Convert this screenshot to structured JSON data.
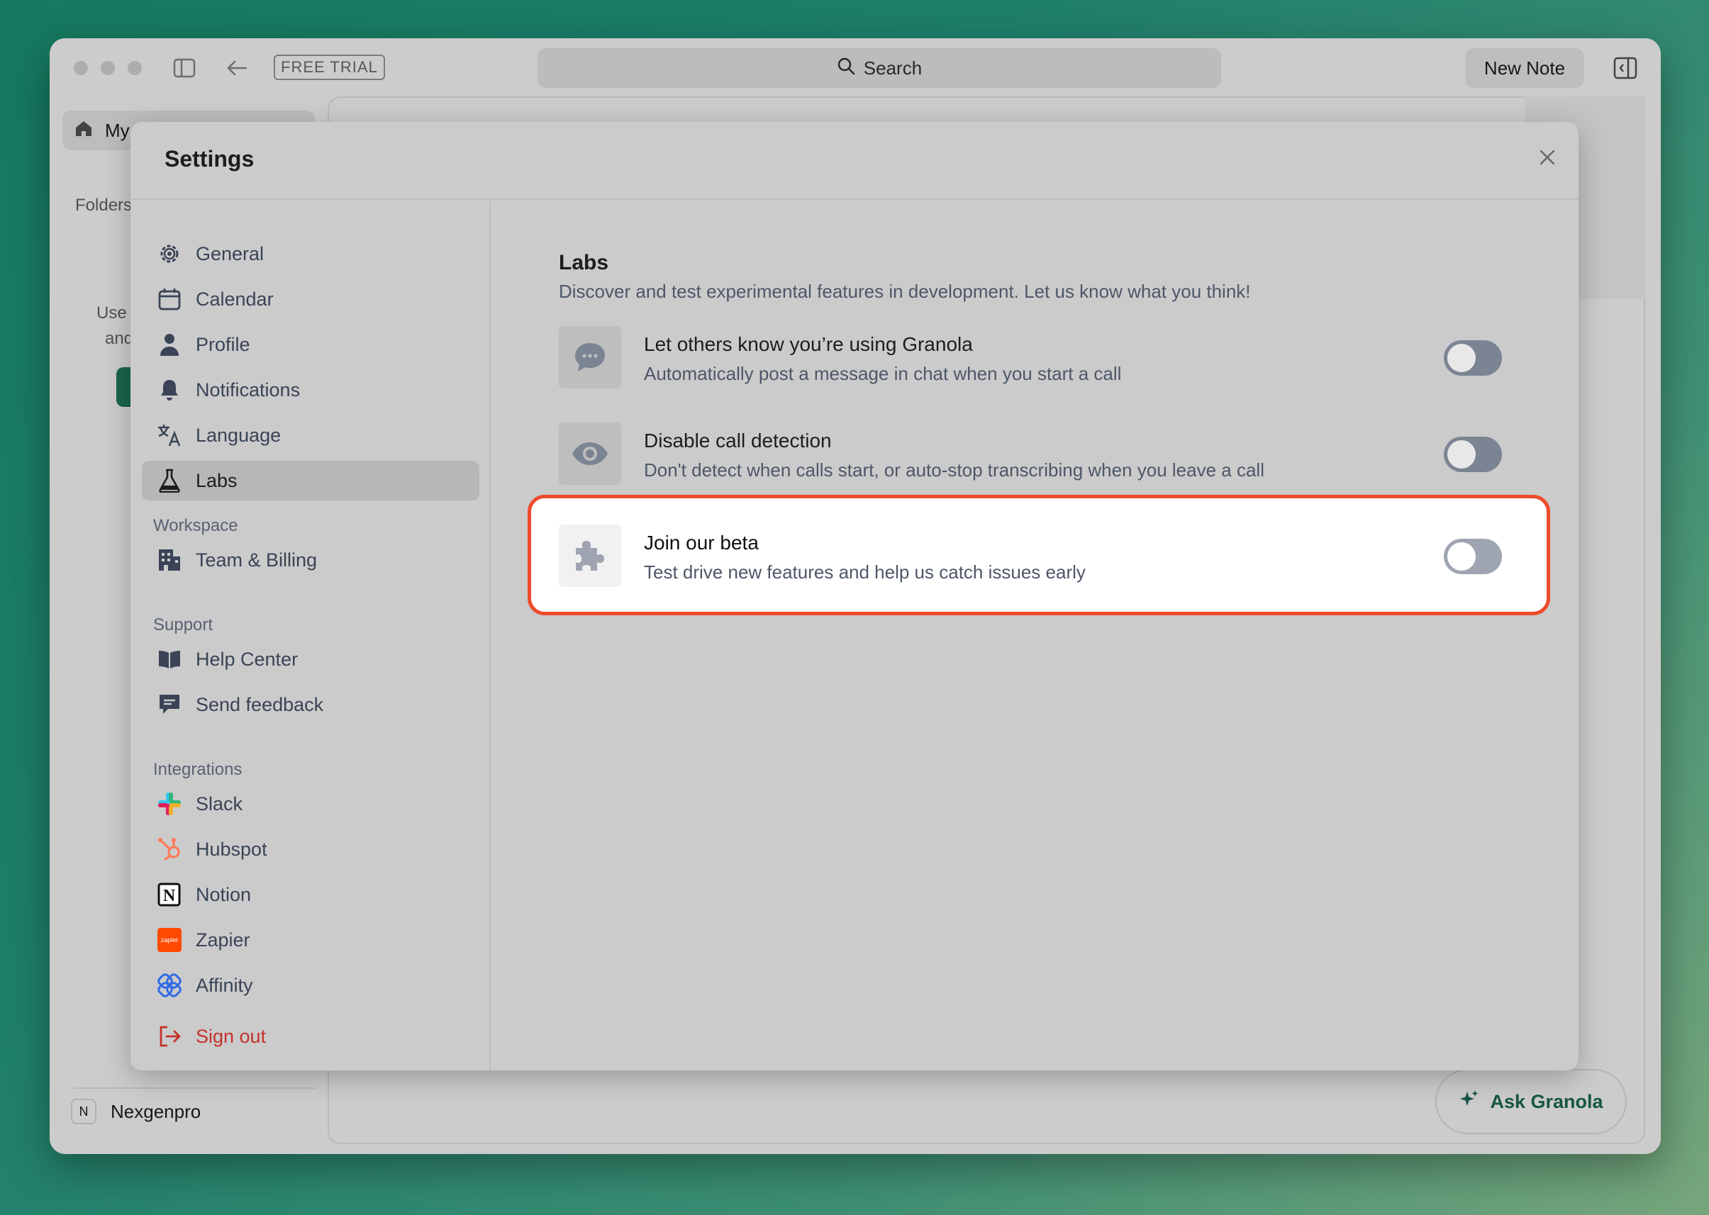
{
  "window": {
    "free_trial": "FREE TRIAL",
    "search_label": "Search",
    "new_note": "New Note"
  },
  "background": {
    "my_item": "My",
    "folders": "Folders",
    "hint_line1": "Use",
    "hint_line2": "and",
    "account_initial": "N",
    "account_name": "Nexgenpro",
    "ask_button": "Ask Granola"
  },
  "settings": {
    "title": "Settings",
    "nav": {
      "general": "General",
      "calendar": "Calendar",
      "profile": "Profile",
      "notifications": "Notifications",
      "language": "Language",
      "labs": "Labs",
      "workspace_section": "Workspace",
      "team_billing": "Team & Billing",
      "support_section": "Support",
      "help_center": "Help Center",
      "send_feedback": "Send feedback",
      "integrations_section": "Integrations",
      "slack": "Slack",
      "hubspot": "Hubspot",
      "notion": "Notion",
      "zapier": "Zapier",
      "zapier_logo_text": "zapier",
      "affinity": "Affinity",
      "sign_out": "Sign out"
    },
    "labs": {
      "title": "Labs",
      "description": "Discover and test experimental features in development. Let us know what you think!",
      "features": [
        {
          "title": "Let others know you’re using Granola",
          "description": "Automatically post a message in chat when you start a call",
          "enabled": false
        },
        {
          "title": "Disable call detection",
          "description": "Don't detect when calls start, or auto-stop transcribing when you leave a call",
          "enabled": false
        },
        {
          "title": "Join our beta",
          "description": "Test drive new features and help us catch issues early",
          "enabled": false
        }
      ]
    }
  },
  "colors": {
    "highlight": "#ee4b2b",
    "accent": "#1f7f5e",
    "danger": "#c4322b"
  }
}
